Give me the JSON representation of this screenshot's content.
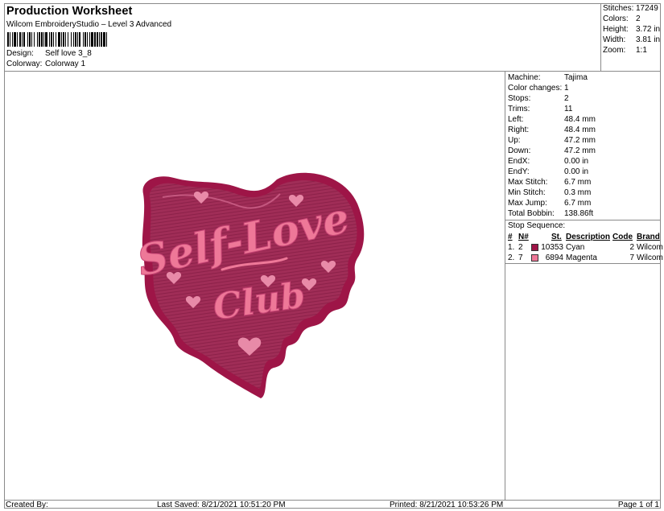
{
  "header": {
    "title": "Production Worksheet",
    "software": "Wilcom EmbroideryStudio – Level 3 Advanced",
    "design_label": "Design:",
    "design_value": "Self love 3_8",
    "colorway_label": "Colorway:",
    "colorway_value": "Colorway 1"
  },
  "stats": {
    "stitches_label": "Stitches:",
    "stitches_value": "17249",
    "colors_label": "Colors:",
    "colors_value": "2",
    "height_label": "Height:",
    "height_value": "3.72 in",
    "width_label": "Width:",
    "width_value": "3.81 in",
    "zoom_label": "Zoom:",
    "zoom_value": "1:1"
  },
  "machine_info": {
    "machine_label": "Machine:",
    "machine_value": "Tajima",
    "color_changes_label": "Color changes:",
    "color_changes_value": "1",
    "stops_label": "Stops:",
    "stops_value": "2",
    "trims_label": "Trims:",
    "trims_value": "11",
    "left_label": "Left:",
    "left_value": "48.4 mm",
    "right_label": "Right:",
    "right_value": "48.4 mm",
    "up_label": "Up:",
    "up_value": "47.2 mm",
    "down_label": "Down:",
    "down_value": "47.2 mm",
    "endx_label": "EndX:",
    "endx_value": "0.00 in",
    "endy_label": "EndY:",
    "endy_value": "0.00 in",
    "max_stitch_label": "Max Stitch:",
    "max_stitch_value": "6.7 mm",
    "min_stitch_label": "Min Stitch:",
    "min_stitch_value": "0.3 mm",
    "max_jump_label": "Max Jump:",
    "max_jump_value": "6.7 mm",
    "total_bobbin_label": "Total Bobbin:",
    "total_bobbin_value": "138.86ft"
  },
  "stop_sequence": {
    "title": "Stop Sequence:",
    "columns": {
      "hash": "#",
      "n": "N#",
      "st": "St.",
      "description": "Description",
      "code": "Code",
      "brand": "Brand"
    },
    "rows": [
      {
        "index": "1.",
        "n": "2",
        "color": "#9e1547",
        "st": "10353",
        "description": "Cyan",
        "code": "2",
        "brand": "Wilcom"
      },
      {
        "index": "2.",
        "n": "7",
        "color": "#ee7898",
        "st": "6894",
        "description": "Magenta",
        "code": "7",
        "brand": "Wilcom"
      }
    ]
  },
  "design_art": {
    "line1": "Self-Love",
    "line2": "Club",
    "outer_color": "#9e1547",
    "fill_color": "#a02d57",
    "text_color": "#ee7898"
  },
  "footer": {
    "created_by": "Created By:",
    "last_saved": "Last Saved: 8/21/2021 10:51:20 PM",
    "printed": "Printed: 8/21/2021 10:53:26 PM",
    "page": "Page 1 of 1"
  }
}
